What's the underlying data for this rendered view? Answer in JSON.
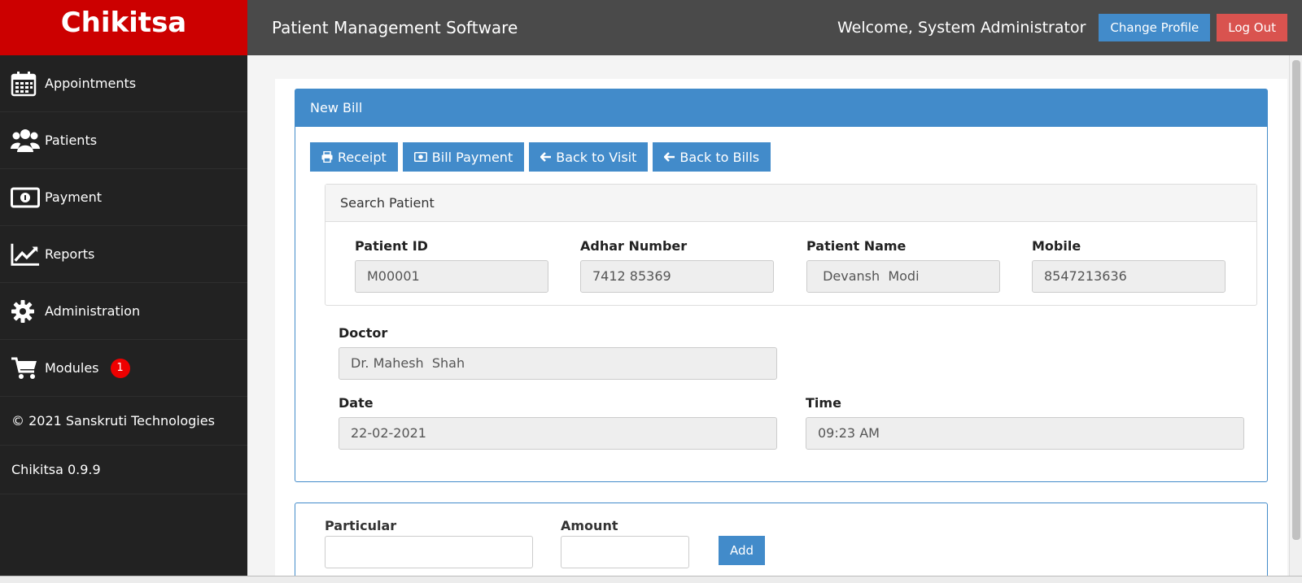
{
  "brand": "Chikitsa",
  "topbar": {
    "title": "Patient Management Software",
    "welcome": "Welcome, System Administrator",
    "change_profile": "Change Profile",
    "logout": "Log Out"
  },
  "sidebar": {
    "items": [
      {
        "label": "Appointments",
        "icon": "calendar-icon"
      },
      {
        "label": "Patients",
        "icon": "users-icon"
      },
      {
        "label": "Payment",
        "icon": "money-icon"
      },
      {
        "label": "Reports",
        "icon": "line-chart-icon"
      },
      {
        "label": "Administration",
        "icon": "gear-icon"
      },
      {
        "label": "Modules",
        "icon": "cart-icon",
        "badge": "1"
      }
    ],
    "copyright": "© 2021 Sanskruti Technologies",
    "version": "Chikitsa 0.9.9"
  },
  "bill": {
    "heading": "New Bill",
    "buttons": {
      "receipt": "Receipt",
      "bill_payment": "Bill Payment",
      "back_to_visit": "Back to Visit",
      "back_to_bills": "Back to Bills"
    },
    "search_heading": "Search Patient",
    "patient_id_label": "Patient ID",
    "patient_id": "M00001",
    "adhar_label": "Adhar Number",
    "adhar": "7412 85369",
    "name_label": "Patient Name",
    "name": " Devansh  Modi",
    "mobile_label": "Mobile",
    "mobile": "8547213636",
    "doctor_label": "Doctor",
    "doctor": "Dr. Mahesh  Shah",
    "date_label": "Date",
    "date": "22-02-2021",
    "time_label": "Time",
    "time": "09:23 AM"
  },
  "particular": {
    "particular_label": "Particular",
    "amount_label": "Amount",
    "add_label": "Add"
  },
  "colors": {
    "brand_red": "#cc0000",
    "primary_blue": "#428bca",
    "danger_red": "#d9534f",
    "sidebar_bg": "#222222",
    "topbar_bg": "#4a4a4a"
  }
}
